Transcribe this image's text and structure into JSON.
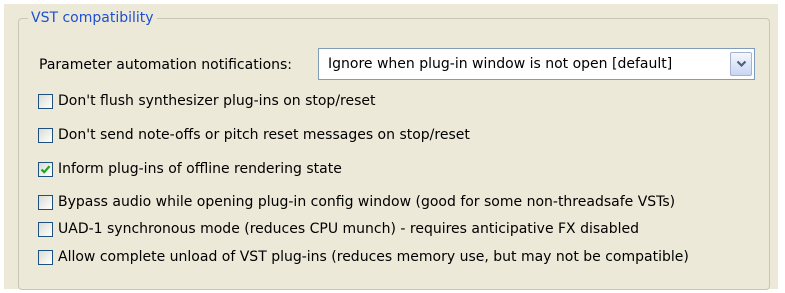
{
  "group": {
    "title": "VST compatibility"
  },
  "parameter_automation": {
    "label": "Parameter automation notifications:",
    "selected": "Ignore when plug-in window is not open [default]",
    "dropdown_icon": "chevron-down-icon"
  },
  "options": [
    {
      "label": "Don't flush synthesizer plug-ins on stop/reset",
      "checked": false
    },
    {
      "label": "Don't send note-offs or pitch reset messages on stop/reset",
      "checked": false
    },
    {
      "label": "Inform plug-ins of offline rendering state",
      "checked": true
    },
    {
      "label": "Bypass audio while opening plug-in config window (good for some non-threadsafe VSTs)",
      "checked": false
    },
    {
      "label": "UAD-1 synchronous mode (reduces CPU munch) - requires anticipative FX disabled",
      "checked": false
    },
    {
      "label": "Allow complete unload of VST plug-ins (reduces memory use, but may not be compatible)",
      "checked": false
    }
  ],
  "colors": {
    "panel_background": "#ece9d8",
    "group_title": "#1e4fcf",
    "checkmark": "#21a121",
    "checkbox_border": "#1c5180"
  }
}
